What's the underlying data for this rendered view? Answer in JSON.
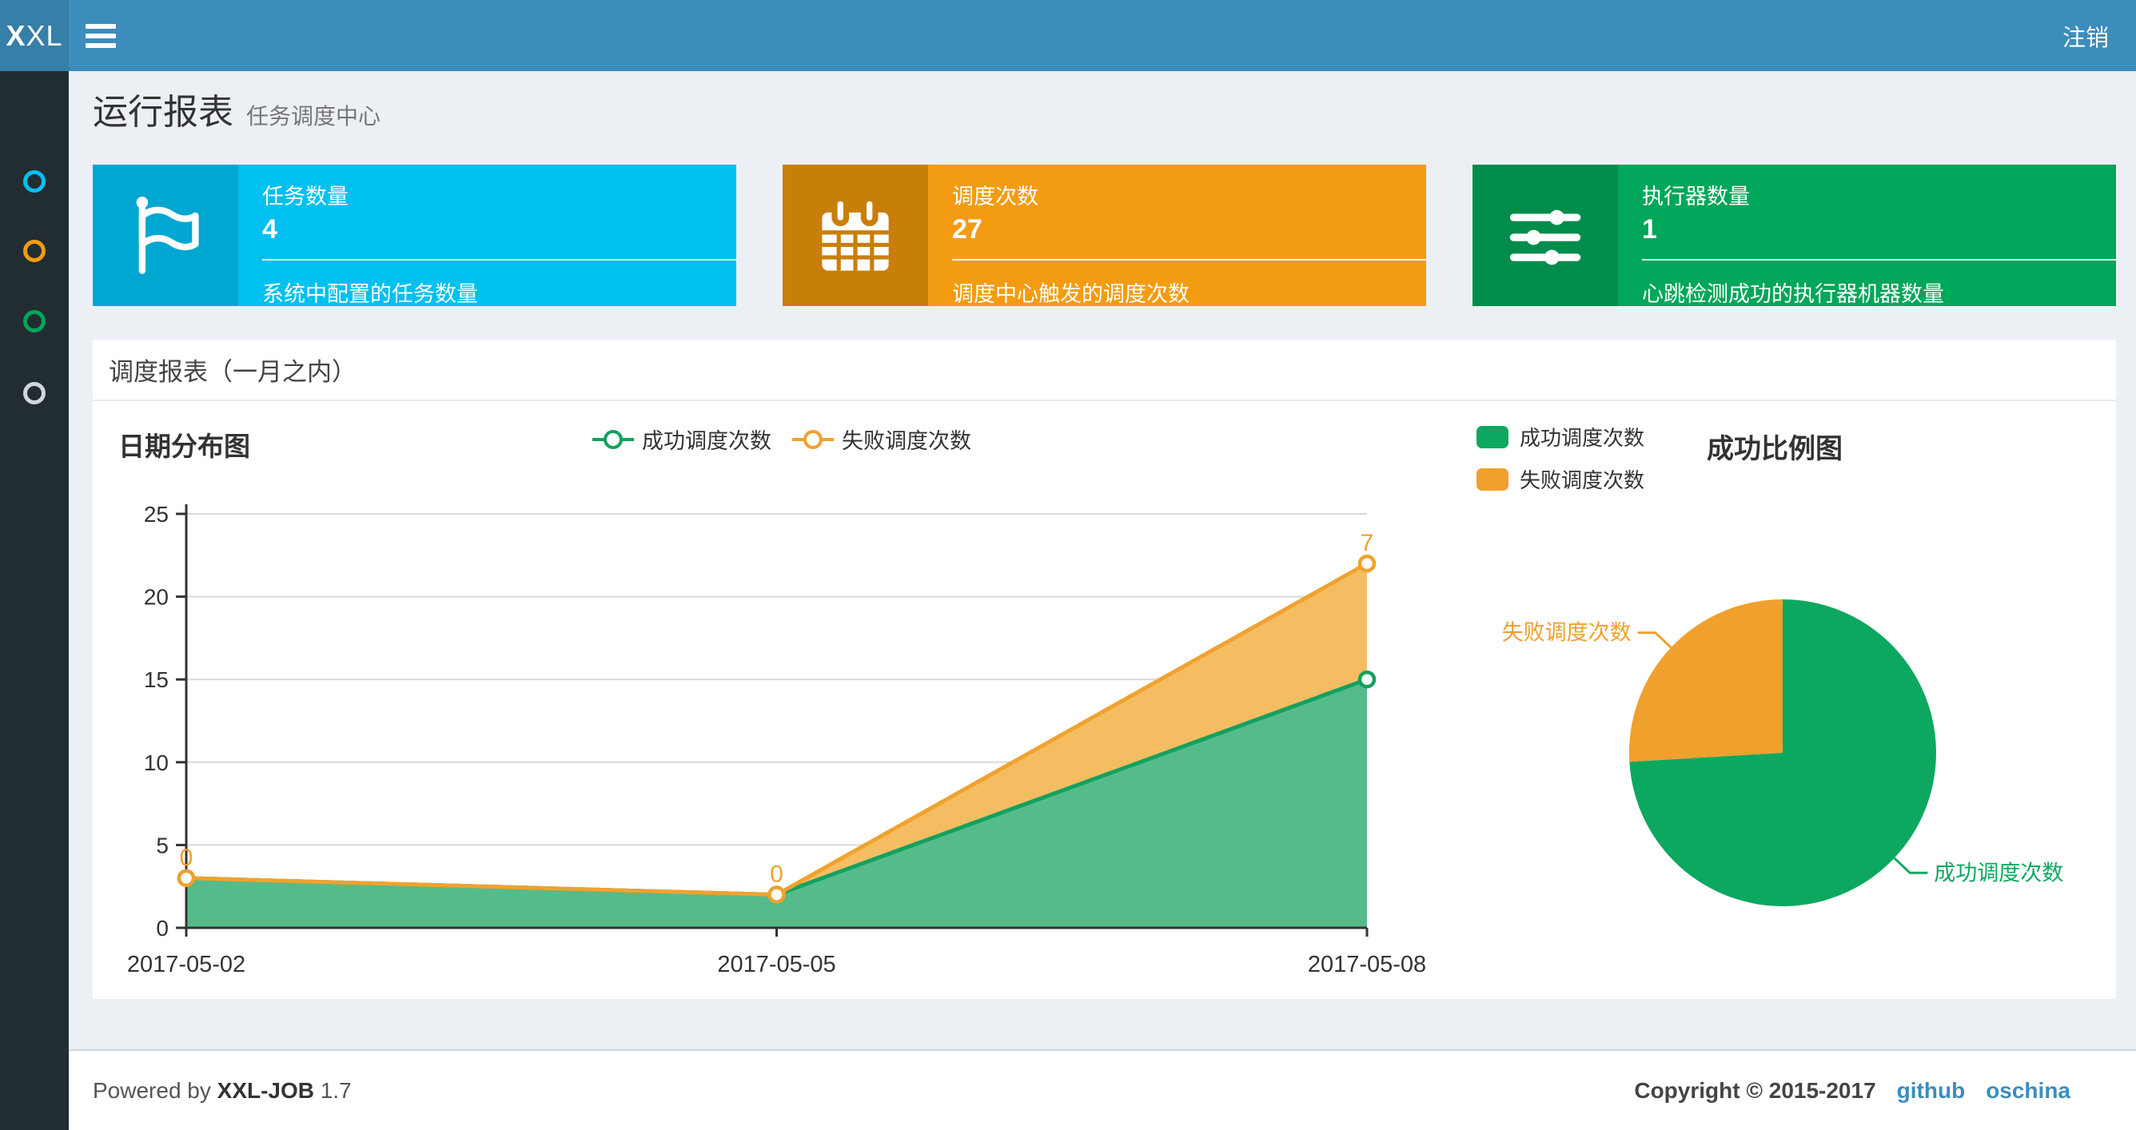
{
  "theme": {
    "navbar_bg": "#3c8dbc",
    "logo_bg": "#367fa9",
    "sidebar_bg": "#222d32",
    "page_bg": "#ecf0f5",
    "link_color": "#3c8dbc"
  },
  "navbar": {
    "logo_bold": "X",
    "logo_rest": "XL",
    "logout_label": "注销"
  },
  "sidebar": {
    "items": [
      {
        "icon": "circle-icon",
        "color": "#00c0ef"
      },
      {
        "icon": "circle-icon",
        "color": "#f39c12"
      },
      {
        "icon": "circle-icon",
        "color": "#00a65a"
      },
      {
        "icon": "circle-icon",
        "color": "#d2d6de"
      }
    ]
  },
  "page_header": {
    "title": "运行报表",
    "subtitle": "任务调度中心"
  },
  "stat_cards": [
    {
      "label": "任务数量",
      "value": "4",
      "desc": "系统中配置的任务数量",
      "bg": "#00c0ef",
      "icon_bg": "#00a7d0",
      "icon": "flag-icon"
    },
    {
      "label": "调度次数",
      "value": "27",
      "desc": "调度中心触发的调度次数",
      "bg": "#f39c12",
      "icon_bg": "#c87f0a",
      "icon": "calendar-icon"
    },
    {
      "label": "执行器数量",
      "value": "1",
      "desc": "心跳检测成功的执行器机器数量",
      "bg": "#00a65a",
      "icon_bg": "#008d4c",
      "icon": "sliders-icon"
    }
  ],
  "panel": {
    "title": "调度报表（一月之内）"
  },
  "chart_data": [
    {
      "type": "area",
      "title": "日期分布图",
      "stacked": true,
      "grid": true,
      "legend_position": "top-center",
      "categories": [
        "2017-05-02",
        "2017-05-05",
        "2017-05-08"
      ],
      "series": [
        {
          "name": "成功调度次数",
          "values": [
            3,
            2,
            15
          ],
          "color": "#13a15f",
          "area_color": "#55bb8b"
        },
        {
          "name": "失败调度次数",
          "values": [
            0,
            0,
            7
          ],
          "color": "#f0a22e",
          "area_color": "#f5bd62",
          "point_labels": [
            "0",
            "0",
            "7"
          ]
        }
      ],
      "ylim": [
        0,
        25
      ],
      "yticks": [
        0,
        5,
        10,
        15,
        20,
        25
      ]
    },
    {
      "type": "pie",
      "title": "成功比例图",
      "legend_position": "top-left",
      "label_position": "outside",
      "total": 27,
      "slices": [
        {
          "name": "成功调度次数",
          "value": 20,
          "color": "#0ca85f"
        },
        {
          "name": "失败调度次数",
          "value": 7,
          "color": "#f0a02c"
        }
      ]
    }
  ],
  "footer": {
    "powered_by": "Powered by",
    "product": "XXL-JOB",
    "version": "1.7",
    "copyright": "Copyright © 2015-2017",
    "links": [
      {
        "label": "github"
      },
      {
        "label": "oschina"
      }
    ]
  }
}
